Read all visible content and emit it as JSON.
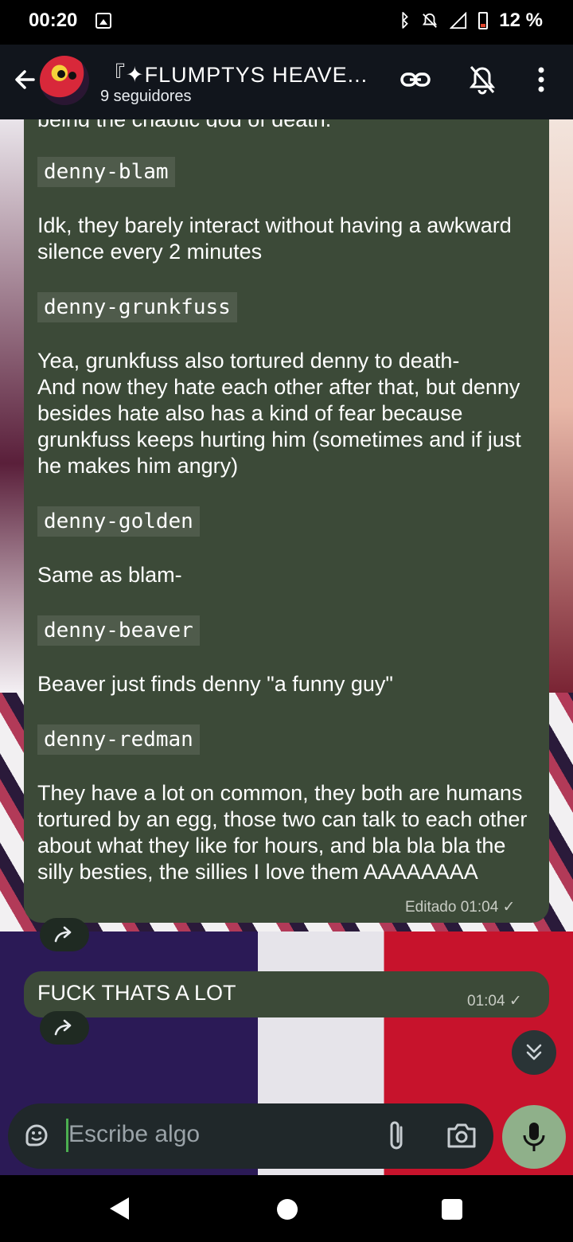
{
  "status_bar": {
    "time": "00:20",
    "battery": "12 %"
  },
  "header": {
    "title": "『✦FLUMPTYS HEAVE...",
    "subtitle": "9 seguidores"
  },
  "messages": {
    "partial_top": "being the chaotic god of death.",
    "blocks": [
      {
        "code": "denny-blam",
        "text": "Idk, they barely interact without having a awkward silence every 2 minutes"
      },
      {
        "code": "denny-grunkfuss",
        "text": "Yea, grunkfuss also tortured denny to death-\nAnd now they hate each other after that, but denny besides hate also has a kind of fear because grunkfuss keeps hurting him (sometimes and if just he makes him angry)"
      },
      {
        "code": "denny-golden",
        "text": "Same as blam-"
      },
      {
        "code": "denny-beaver",
        "text": "Beaver just finds denny \"a funny guy\""
      },
      {
        "code": "denny-redman",
        "text": "They have a lot on common, they both are humans tortured by an egg, those two can talk to each other about what they like for hours, and bla bla bla the silly besties, the sillies I love them AAAAAAAA"
      }
    ],
    "first_meta": "Editado 01:04 ✓",
    "second_text": "FUCK THATS A LOT",
    "second_meta": "01:04 ✓"
  },
  "input": {
    "placeholder": "Escribe algo"
  },
  "icons": {
    "back": "back-arrow-icon",
    "link": "link-icon",
    "mute": "bell-off-icon",
    "menu": "more-vert-icon",
    "forward": "forward-icon",
    "scroll": "chevron-double-down-icon",
    "emoji": "sticker-icon",
    "attach": "paperclip-icon",
    "camera": "camera-icon",
    "mic": "mic-icon"
  }
}
